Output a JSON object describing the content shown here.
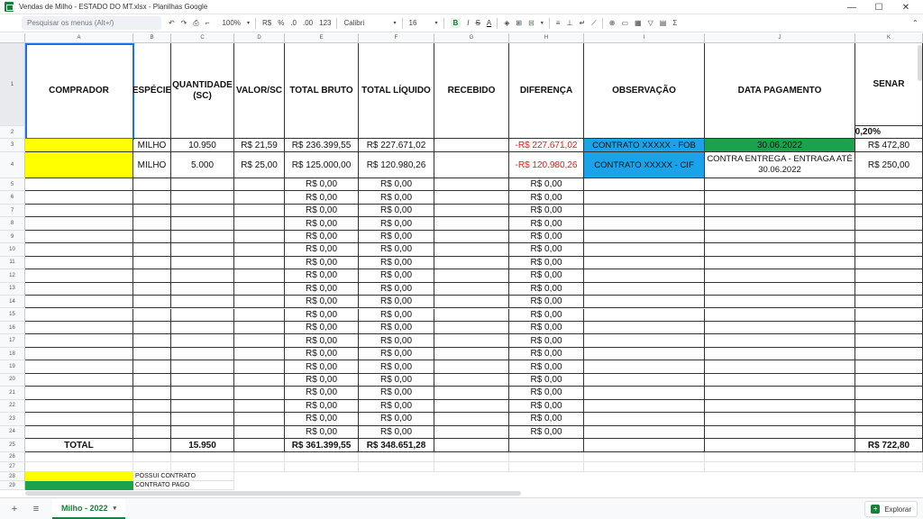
{
  "window": {
    "title": "Vendas de Milho - ESTADO DO MT.xlsx - Planilhas Google",
    "minimize": "—",
    "maximize": "☐",
    "close": "✕"
  },
  "toolbar": {
    "search_placeholder": "Pesquisar os menus (Alt+/)",
    "undo": "↶",
    "redo": "↷",
    "print": "⎙",
    "paint_format": "⌐",
    "zoom": "100%",
    "currency": "R$",
    "percent": "%",
    "decrease_decimals": ".0",
    "increase_decimals": ".00",
    "more_formats": "123",
    "font": "Calibri",
    "font_size": "16",
    "bold": "B",
    "italic": "I",
    "strike": "S",
    "text_color": "A",
    "fill": "◈",
    "borders": "⊞",
    "merge": "⊟",
    "h_align": "≡",
    "v_align": "⊥",
    "wrap": "↵",
    "rotate": "⟋",
    "link": "⊕",
    "comment": "▭",
    "chart": "▦",
    "filter": "▽",
    "views": "▤",
    "functions": "Σ",
    "collapse": "⌃"
  },
  "columns": [
    "A",
    "B",
    "C",
    "D",
    "E",
    "F",
    "G",
    "H",
    "I",
    "J",
    "K"
  ],
  "headers": {
    "comprador": "COMPRADOR",
    "especie": "ESPÉCIE",
    "quantidade": "QUANTIDADE (SC)",
    "valor": "VALOR/SC",
    "total_bruto": "TOTAL BRUTO",
    "total_liquido": "TOTAL LÍQUIDO",
    "recebido": "RECEBIDO",
    "diferenca": "DIFERENÇA",
    "observacao": "OBSERVAÇÃO",
    "data_pagamento": "DATA PAGAMENTO",
    "senar": "SENAR"
  },
  "row2": {
    "senar_rate": "0,20%"
  },
  "rows": [
    {
      "especie": "MILHO",
      "quantidade": "10.950",
      "valor": "R$ 21,59",
      "total_bruto": "R$ 236.399,55",
      "total_liquido": "R$ 227.671,02",
      "diferenca": "-R$ 227.671,02",
      "observacao": "CONTRATO XXXXX - FOB",
      "data_pagamento": "30.06.2022",
      "senar": "R$ 472,80"
    },
    {
      "especie": "MILHO",
      "quantidade": "5.000",
      "valor": "R$ 25,00",
      "total_bruto": "R$ 125.000,00",
      "total_liquido": "R$ 120.980,26",
      "diferenca": "-R$ 120.980,26",
      "observacao": "CONTRATO XXXXX - CIF",
      "data_pagamento": "CONTRA ENTREGA - ENTRAGA ATÉ 30.06.2022",
      "senar": "R$ 250,00"
    }
  ],
  "empty_value": "R$ 0,00",
  "row_numbers": [
    "1",
    "2",
    "3",
    "4",
    "5",
    "6",
    "7",
    "8",
    "9",
    "10",
    "11",
    "12",
    "13",
    "14",
    "15",
    "16",
    "17",
    "18",
    "19",
    "20",
    "21",
    "22",
    "23",
    "24",
    "25",
    "26",
    "27",
    "28",
    "29"
  ],
  "totals": {
    "label": "TOTAL",
    "quantidade": "15.950",
    "total_bruto": "R$ 361.399,55",
    "total_liquido": "R$ 348.651,28",
    "senar": "R$ 722,80"
  },
  "legend": [
    {
      "label": "POSSUI CONTRATO",
      "color": "#ffff00"
    },
    {
      "label": "CONTRATO PAGO",
      "color": "#1aa34a"
    }
  ],
  "colors": {
    "yellow": "#ffff00",
    "green": "#1aa34a",
    "blue": "#1aa3e8",
    "red_text": "#e02020"
  },
  "sheetbar": {
    "add_sheet": "+",
    "all_sheets": "≡",
    "active_tab": "Milho - 2022",
    "tab_caret": "▾",
    "explore": "Explorar",
    "explore_icon": "+"
  }
}
